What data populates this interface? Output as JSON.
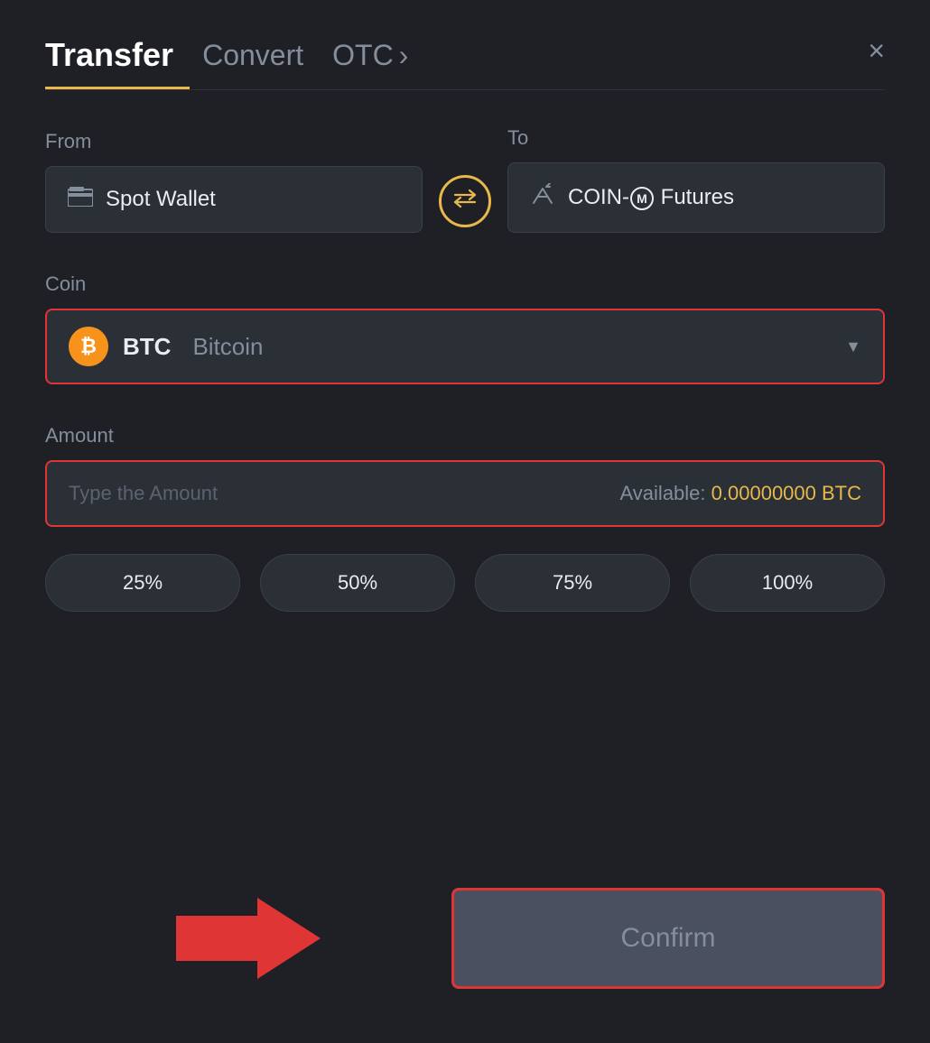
{
  "header": {
    "tab_transfer": "Transfer",
    "tab_convert": "Convert",
    "tab_otc": "OTC",
    "otc_chevron": "›",
    "close_label": "×"
  },
  "from_section": {
    "label": "From",
    "wallet_icon": "▬",
    "wallet_name": "Spot Wallet"
  },
  "to_section": {
    "label": "To",
    "wallet_icon": "↑",
    "wallet_name": "COIN-M Futures"
  },
  "swap": {
    "icon": "⇄"
  },
  "coin_section": {
    "label": "Coin",
    "coin_symbol": "BTC",
    "coin_name": "Bitcoin",
    "btc_glyph": "₿"
  },
  "amount_section": {
    "label": "Amount",
    "placeholder": "Type the Amount",
    "available_label": "Available:",
    "available_value": "0.00000000 BTC"
  },
  "percentage_buttons": [
    {
      "label": "25%"
    },
    {
      "label": "50%"
    },
    {
      "label": "75%"
    },
    {
      "label": "100%"
    }
  ],
  "confirm_button": {
    "label": "Confirm"
  }
}
